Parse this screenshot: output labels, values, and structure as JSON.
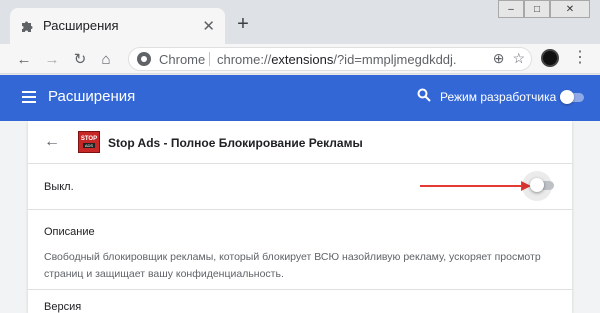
{
  "browser": {
    "tab_title": "Расширения",
    "new_tab_glyph": "+",
    "url_scheme_label": "Chrome",
    "url_prefix": "chrome://",
    "url_host": "extensions",
    "url_rest": "/?id=mmpljmegdkddj...",
    "window_controls": [
      "–",
      "□",
      "✕"
    ]
  },
  "header": {
    "title": "Расширения",
    "dev_mode_label": "Режим разработчика",
    "dev_mode_on": false
  },
  "extension": {
    "name": "Stop Ads - Полное Блокирование Рекламы",
    "logo_top": "STOP",
    "logo_bottom": "ADS",
    "status_label": "Выкл.",
    "enabled": false,
    "description_heading": "Описание",
    "description": "Свободный блокировщик рекламы, который блокирует ВСЮ назойливую рекламу, ускоряет просмотр страниц и защищает вашу конфиденциальность.",
    "next_section_label": "Версия"
  },
  "colors": {
    "header_blue": "#3367d6",
    "annotation_arrow": "#e53935",
    "logo_red": "#c62828"
  }
}
